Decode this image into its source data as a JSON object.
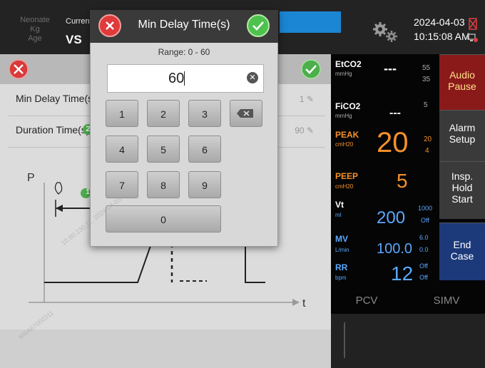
{
  "topbar": {
    "patient_fields": [
      "Neonate",
      "Kg",
      "Age"
    ],
    "current_label": "Current",
    "mode_label": "VS",
    "date": "2024-04-03",
    "time": "10:15:08 AM",
    "accent_color": "#1a86d4"
  },
  "settings": [
    {
      "label": "Min Delay Time(s)",
      "badge": "1",
      "value": "1"
    },
    {
      "label": "Duration Time(s)",
      "badge": "2",
      "value": "90"
    }
  ],
  "graph": {
    "y_axis": "P",
    "x_axis": "t",
    "marker": "1"
  },
  "dialog": {
    "title": "Min Delay Time(s)",
    "range": "Range: 0 - 60",
    "value": "60",
    "keys": [
      "1",
      "2",
      "3",
      "4",
      "5",
      "6",
      "7",
      "8",
      "9",
      "0"
    ]
  },
  "monitor": {
    "etco2": {
      "label": "EtCO2",
      "unit": "mmHg",
      "value": "---",
      "hi": "55",
      "lo": "35"
    },
    "fico2": {
      "label": "FiCO2",
      "unit": "mmHg",
      "value": "---",
      "hi": "5"
    },
    "peak": {
      "label": "PEAK",
      "unit": "cmH20",
      "value": "20",
      "hi": "20",
      "lo": "4"
    },
    "peep": {
      "label": "PEEP",
      "unit": "cmH20",
      "value": "5"
    },
    "vt": {
      "label": "Vt",
      "unit": "ml",
      "value": "200",
      "hi": "1000",
      "lo": "Off"
    },
    "mv": {
      "label": "MV",
      "unit": "L/min",
      "value": "100.0",
      "hi": "6.0",
      "lo": "0.0"
    },
    "rr": {
      "label": "RR",
      "unit": "bpm",
      "value": "12",
      "hi": "Off",
      "lo": "Off"
    }
  },
  "side_buttons": {
    "audio_pause": [
      "Audio",
      "Pause"
    ],
    "alarm_setup": [
      "Alarm",
      "Setup"
    ],
    "insp_hold": [
      "Insp.",
      "Hold",
      "Start"
    ],
    "end_case": [
      "End",
      "Case"
    ]
  },
  "modes": {
    "pcv": "PCV",
    "simv": "SIMV"
  },
  "watermark": "10.80.230.17, 2024-04-03",
  "watermark_id": "MRA67000311"
}
